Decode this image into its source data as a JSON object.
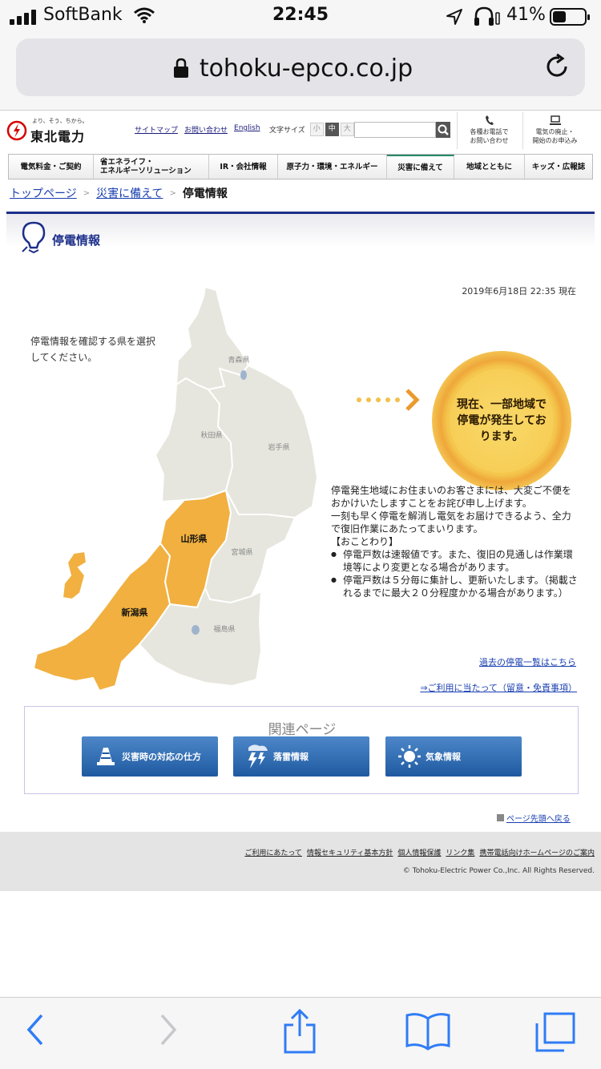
{
  "status_bar": {
    "carrier": "SoftBank",
    "time": "22:45",
    "battery": "41%",
    "battery_level": 0.41
  },
  "browser": {
    "url": "tohoku-epco.co.jp"
  },
  "header": {
    "logo_tagline": "より、そう、ちから。",
    "logo_name": "東北電力",
    "links": [
      "サイトマップ",
      "お問い合わせ",
      "English"
    ],
    "font_size_label": "文字サイズ",
    "font_sizes": [
      "小",
      "中",
      "大"
    ],
    "utility": [
      {
        "line1": "各種お電話で",
        "line2": "お問い合わせ"
      },
      {
        "line1": "電気の廃止・",
        "line2": "開始のお申込み"
      }
    ]
  },
  "nav": [
    {
      "label": "電気料金・ご契約"
    },
    {
      "label": "省エネライフ・",
      "label2": "エネルギーソリューション"
    },
    {
      "label": "IR・会社情報"
    },
    {
      "label": "原子力・環境・エネルギー"
    },
    {
      "label": "災害に備えて"
    },
    {
      "label": "地域とともに"
    },
    {
      "label": "キッズ・広報誌"
    }
  ],
  "breadcrumb": {
    "home": "トップページ",
    "parent": "災害に備えて",
    "current": "停電情報"
  },
  "page_title": "停電情報",
  "timestamp": "2019年6月18日 22:35 現在",
  "instruction": "停電情報を確認する県を選択してください。",
  "map": {
    "labels": {
      "aomori": "青森県",
      "akita": "秋田県",
      "iwate": "岩手県",
      "yamagata": "山形県",
      "miyagi": "宮城県",
      "niigata": "新潟県",
      "fukushima": "福島県"
    },
    "colors": {
      "outage": "#f1b03f",
      "normal": "#e6e6de",
      "border": "#ffffff",
      "label_normal": "#888888",
      "label_outage": "#111111"
    }
  },
  "status_badge": "現在、一部地域で停電が発生しております。",
  "notice": {
    "p1": "停電発生地域にお住まいのお客さまには、大変ご不便をおかけいたしますことをお詫び申し上げます。",
    "p2": "一刻も早く停電を解消し電気をお届けできるよう、全力で復旧作業にあたってまいります。",
    "disclaimer_heading": "【おことわり】",
    "items": [
      "停電戸数は速報値です。また、復旧の見通しは作業環境等により変更となる場合があります。",
      "停電戸数は５分毎に集計し、更新いたします。（掲載されるまでに最大２０分程度かかる場合があります。）"
    ]
  },
  "links": {
    "past": "過去の停電一覧はこちら",
    "terms": "⇒ご利用に当たって（留意・免責事項）"
  },
  "related": {
    "title": "関連ページ",
    "buttons": [
      {
        "label": "災害時の対応の仕方",
        "icon": "traffic-cone-icon"
      },
      {
        "label": "落雷情報",
        "icon": "lightning-icon"
      },
      {
        "label": "気象情報",
        "icon": "sun-icon"
      }
    ]
  },
  "back_to_top": "ページ先頭へ戻る",
  "footer": {
    "links": [
      "ご利用にあたって",
      "情報セキュリティ基本方針",
      "個人情報保護",
      "リンク集",
      "携帯電話向けホームページのご案内"
    ],
    "copyright": "© Tohoku-Electric Power Co.,Inc. All Rights Reserved."
  }
}
